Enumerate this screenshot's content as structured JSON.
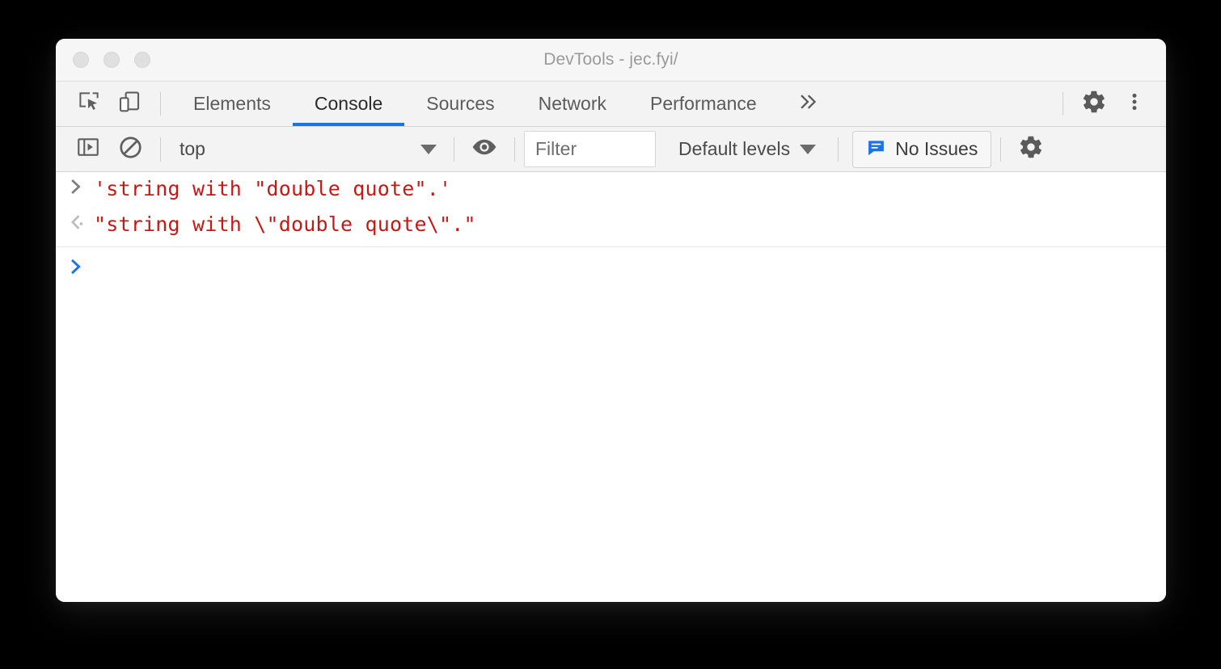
{
  "window": {
    "title": "DevTools - jec.fyi/",
    "traffic_lights": [
      "close",
      "minimize",
      "zoom"
    ]
  },
  "colors": {
    "accent_blue": "#1a73e8",
    "string_red": "#c41a16",
    "toolbar_bg": "#f3f3f3",
    "titlebar_bg": "#f6f6f6",
    "tab_inactive": "#5b5b5b",
    "tab_active": "#2b2b2b"
  },
  "tabbar": {
    "inspect_icon": "inspect-element-icon",
    "device_icon": "device-toolbar-icon",
    "tabs": [
      {
        "label": "Elements",
        "active": false
      },
      {
        "label": "Console",
        "active": true
      },
      {
        "label": "Sources",
        "active": false
      },
      {
        "label": "Network",
        "active": false
      },
      {
        "label": "Performance",
        "active": false
      }
    ],
    "more_tabs": "»",
    "settings_icon": "gear-icon",
    "menu_icon": "more-vertical-icon"
  },
  "console_toolbar": {
    "sidebar_toggle_icon": "console-sidebar-icon",
    "clear_console_icon": "clear-console-icon",
    "context": {
      "value": "top",
      "caret": "▼"
    },
    "live_expression_icon": "eye-icon",
    "filter": {
      "value": "",
      "placeholder": "Filter"
    },
    "levels": {
      "value": "Default levels",
      "caret": "▼"
    },
    "issues": {
      "label": "No Issues",
      "icon": "issues-message-icon"
    },
    "settings_icon": "gear-icon"
  },
  "console": {
    "rows": [
      {
        "type": "input",
        "marker": ">",
        "text": "'string with \"double quote\".'"
      },
      {
        "type": "output",
        "marker": "‹·",
        "text": "\"string with \\\"double quote\\\".\""
      }
    ],
    "prompt": {
      "marker": ">",
      "value": ""
    }
  }
}
